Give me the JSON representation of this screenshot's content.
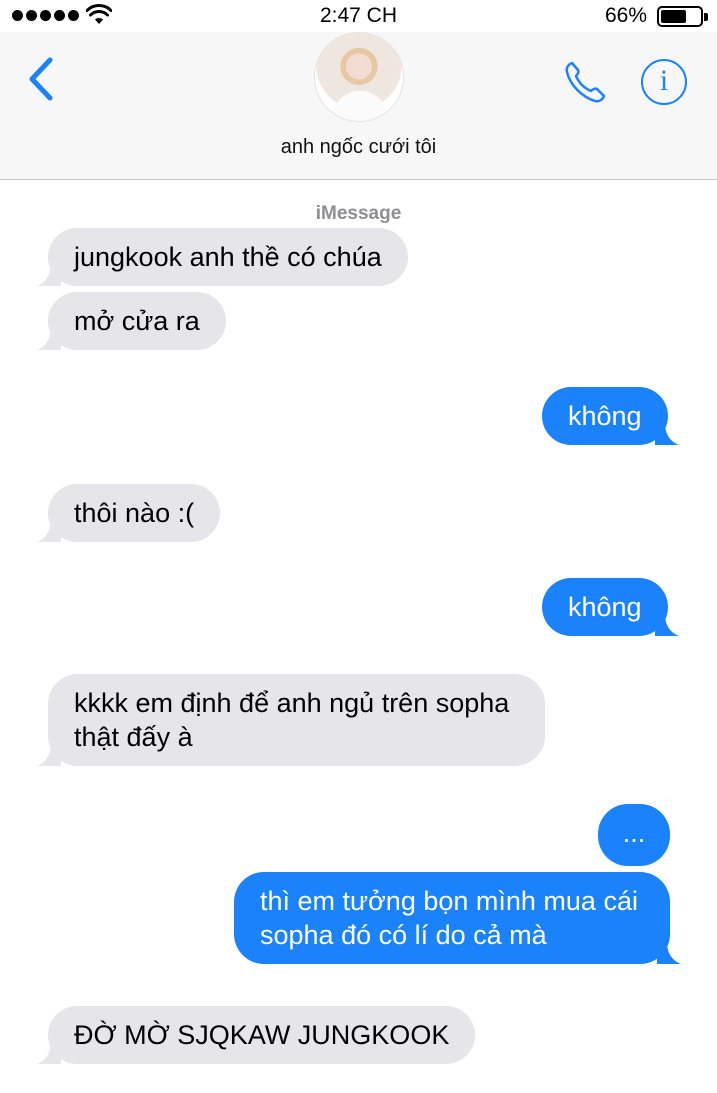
{
  "status_bar": {
    "time": "2:47 CH",
    "battery_percent": "66%",
    "battery_level": 0.66
  },
  "header": {
    "contact_name": "anh ngốc cưới tôi",
    "info_glyph": "i",
    "icons": [
      "back-chevron-icon",
      "avatar",
      "phone-icon",
      "info-icon"
    ]
  },
  "conversation": {
    "service_label": "iMessage",
    "messages": [
      {
        "from": "them",
        "text": "jungkook anh thề có chúa"
      },
      {
        "from": "them",
        "text": "mở cửa ra"
      },
      {
        "from": "me",
        "text": "không"
      },
      {
        "from": "them",
        "text": "thôi nào :("
      },
      {
        "from": "me",
        "text": "không"
      },
      {
        "from": "them",
        "text_line1": "kkkk em định để anh ngủ trên sopha",
        "text_line2": "thật đấy à"
      },
      {
        "from": "me",
        "text": "..."
      },
      {
        "from": "me",
        "text_line1": "thì em tưởng bọn mình mua cái",
        "text_line2": "sopha đó có lí do cả mà"
      },
      {
        "from": "them",
        "text": "ĐỜ MỜ SJQKAW JUNGKOOK"
      }
    ]
  },
  "colors": {
    "accent_blue": "#1a82fb",
    "received_bubble": "#e5e5ea",
    "header_bg": "#f7f7f7",
    "service_label": "#8e8e93"
  }
}
